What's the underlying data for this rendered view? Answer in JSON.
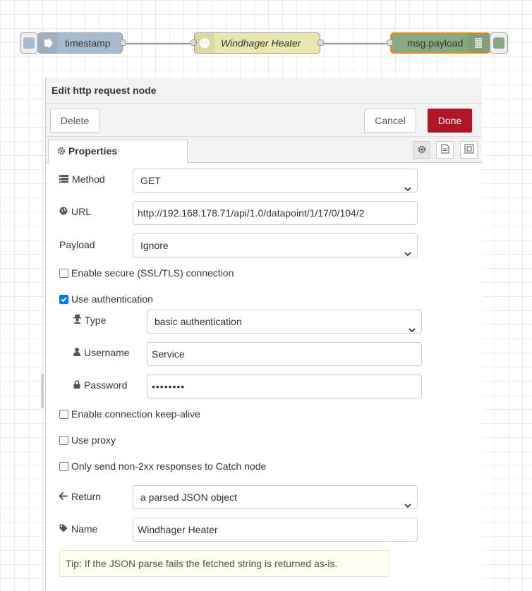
{
  "flow": {
    "inject_node": {
      "label": "timestamp",
      "color": "#a6bbcf"
    },
    "http_node": {
      "label": "Windhager Heater",
      "color": "#e7e7ae"
    },
    "debug_node": {
      "label": "msg.payload",
      "color": "#87a980",
      "selected_outline": "#ff7f0e"
    }
  },
  "tray": {
    "title": "Edit http request node",
    "delete_label": "Delete",
    "cancel_label": "Cancel",
    "done_label": "Done",
    "tab_label": "Properties"
  },
  "form": {
    "method": {
      "label": "Method",
      "value": "GET",
      "icon": "list-icon"
    },
    "url": {
      "label": "URL",
      "value": "http://192.168.178.71/api/1.0/datapoint/1/17/0/104/2",
      "icon": "globe-icon"
    },
    "payload": {
      "label": "Payload",
      "value": "Ignore"
    },
    "ssl": {
      "label": "Enable secure (SSL/TLS) connection",
      "checked": false
    },
    "auth": {
      "label": "Use authentication",
      "checked": true
    },
    "auth_type": {
      "label": "Type",
      "value": "basic authentication",
      "icon": "user-secret-icon"
    },
    "username": {
      "label": "Username",
      "value": "Service",
      "icon": "user-icon"
    },
    "password": {
      "label": "Password",
      "value": "••••••••",
      "icon": "lock-icon"
    },
    "keepalive": {
      "label": "Enable connection keep-alive",
      "checked": false
    },
    "proxy": {
      "label": "Use proxy",
      "checked": false
    },
    "non2xx": {
      "label": "Only send non-2xx responses to Catch node",
      "checked": false
    },
    "return": {
      "label": "Return",
      "value": "a parsed JSON object",
      "icon": "arrow-left-icon"
    },
    "name": {
      "label": "Name",
      "value": "Windhager Heater",
      "icon": "tag-icon"
    },
    "tip": "Tip: If the JSON parse fails the fetched string is returned as-is."
  }
}
